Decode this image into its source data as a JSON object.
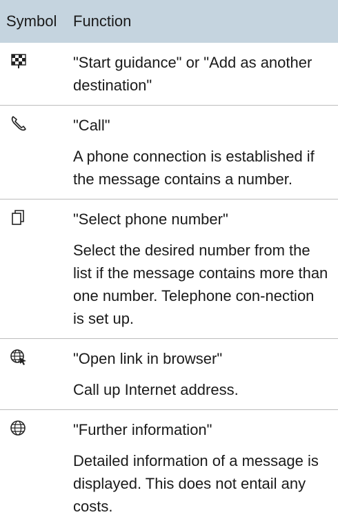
{
  "table": {
    "headers": {
      "symbol": "Symbol",
      "function": "Function"
    },
    "rows": [
      {
        "icon": "destination-flag-icon",
        "title": "\"Start guidance\" or \"Add as another destination\"",
        "description": ""
      },
      {
        "icon": "phone-handset-icon",
        "title": "\"Call\"",
        "description": "A phone connection is established if the message contains a number."
      },
      {
        "icon": "phone-number-list-icon",
        "title": "\"Select phone number\"",
        "description": "Select the desired number from the list if the message contains more than one number. Telephone con-nection is set up."
      },
      {
        "icon": "globe-cursor-icon",
        "title": "\"Open link in browser\"",
        "description": "Call up Internet address."
      },
      {
        "icon": "globe-info-icon",
        "title": "\"Further information\"",
        "description": "Detailed information of a message is displayed. This does not entail any costs."
      }
    ]
  }
}
